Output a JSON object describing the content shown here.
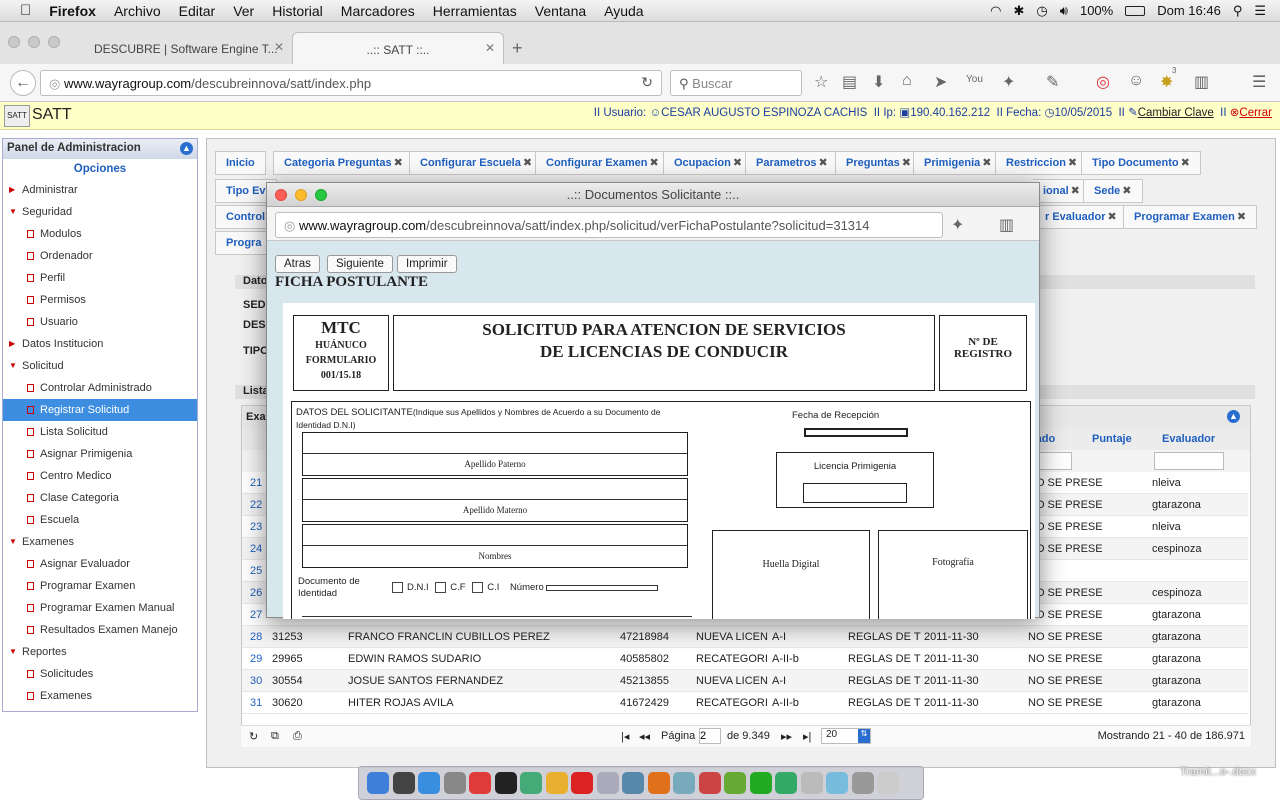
{
  "menubar": {
    "app": "Firefox",
    "items": [
      "Archivo",
      "Editar",
      "Ver",
      "Historial",
      "Marcadores",
      "Herramientas",
      "Ventana",
      "Ayuda"
    ],
    "battery": "100%",
    "clock": "Dom 16:46"
  },
  "browser": {
    "tabs": [
      {
        "title": "DESCUBRE | Software Engine T..."
      },
      {
        "title": "..:: SATT ::.."
      }
    ],
    "url_domain": "www.wayragroup.com",
    "url_path": "/descubreinnova/satt/index.php",
    "search_placeholder": "Buscar",
    "badge": "3"
  },
  "satt": {
    "logo_text": "SATT",
    "title": "SATT",
    "user_label": "II  Usuario:",
    "user": "CESAR AUGUSTO ESPINOZA CACHIS",
    "ip_label": "II  Ip:",
    "ip": "190.40.162.212",
    "date_label": "II  Fecha:",
    "date": "10/05/2015",
    "sep": "II",
    "change_pwd": "Cambiar Clave",
    "logout": "Cerrar"
  },
  "sidebar": {
    "title": "Panel de Administracion",
    "options": "Opciones",
    "items": [
      {
        "label": "Administrar",
        "level": 1
      },
      {
        "label": "Seguridad",
        "level": 1
      },
      {
        "label": "Modulos",
        "level": 2
      },
      {
        "label": "Ordenador",
        "level": 2
      },
      {
        "label": "Perfil",
        "level": 2
      },
      {
        "label": "Permisos",
        "level": 2
      },
      {
        "label": "Usuario",
        "level": 2
      },
      {
        "label": "Datos Institucion",
        "level": 1
      },
      {
        "label": "Solicitud",
        "level": 1
      },
      {
        "label": "Controlar Administrado",
        "level": 2
      },
      {
        "label": "Registrar Solicitud",
        "level": 2,
        "selected": true
      },
      {
        "label": "Lista Solicitud",
        "level": 2
      },
      {
        "label": "Asignar Primigenia",
        "level": 2
      },
      {
        "label": "Centro Medico",
        "level": 2
      },
      {
        "label": "Clase Categoria",
        "level": 2
      },
      {
        "label": "Escuela",
        "level": 2
      },
      {
        "label": "Examenes",
        "level": 1
      },
      {
        "label": "Asignar Evaluador",
        "level": 2
      },
      {
        "label": "Programar Examen",
        "level": 2
      },
      {
        "label": "Programar Examen Manual",
        "level": 2
      },
      {
        "label": "Resultados Examen Manejo",
        "level": 2
      },
      {
        "label": "Reportes",
        "level": 1
      },
      {
        "label": "Solicitudes",
        "level": 2
      },
      {
        "label": "Examenes",
        "level": 2
      }
    ]
  },
  "main_tabs": {
    "row1": [
      "Inicio",
      "Categoria Preguntas",
      "Configurar Escuela",
      "Configurar Examen",
      "Ocupacion",
      "Parametros",
      "Preguntas",
      "Primigenia",
      "Restriccion",
      "Tipo Documento"
    ],
    "row2_visible": [
      "Tipo Ev",
      "ional",
      "Sede"
    ],
    "row3_visible": [
      "Control",
      "r Evaluador",
      "Programar Examen"
    ],
    "row4_visible": [
      "Progra"
    ]
  },
  "sections": {
    "datos": "Dato",
    "fields": [
      "SED",
      "DES",
      "TIPO"
    ],
    "lista": "Lista",
    "exam": "Exam"
  },
  "grid": {
    "headers": {
      "estado": "tado",
      "puntaje": "Puntaje",
      "evaluador": "Evaluador"
    },
    "partial_rows": [
      {
        "n": "21",
        "estado": "NO SE PRESE",
        "evaluador": "nleiva"
      },
      {
        "n": "22",
        "estado": "NO SE PRESE",
        "evaluador": "gtarazona"
      },
      {
        "n": "23",
        "estado": "NO SE PRESE",
        "evaluador": "nleiva"
      },
      {
        "n": "24",
        "estado": "NO SE PRESE",
        "evaluador": "cespinoza"
      },
      {
        "n": "25",
        "estado": "",
        "evaluador": ""
      },
      {
        "n": "26",
        "estado": "NO SE PRESE",
        "evaluador": "cespinoza"
      },
      {
        "n": "27",
        "estado": "NO SE PRESE",
        "evaluador": "gtarazona"
      }
    ],
    "rows": [
      {
        "n": "28",
        "id": "31253",
        "name": "FRANCO FRANCLIN CUBILLOS PEREZ",
        "dni": "47218984",
        "tramite": "NUEVA LICEN",
        "cat": "A-I",
        "exam": "REGLAS DE T",
        "date": "2011-11-30",
        "estado": "NO SE PRESE",
        "evaluador": "gtarazona"
      },
      {
        "n": "29",
        "id": "29965",
        "name": "EDWIN RAMOS SUDARIO",
        "dni": "40585802",
        "tramite": "RECATEGORI",
        "cat": "A-II-b",
        "exam": "REGLAS DE T",
        "date": "2011-11-30",
        "estado": "NO SE PRESE",
        "evaluador": "gtarazona"
      },
      {
        "n": "30",
        "id": "30554",
        "name": "JOSUE SANTOS FERNANDEZ",
        "dni": "45213855",
        "tramite": "NUEVA LICEN",
        "cat": "A-I",
        "exam": "REGLAS DE T",
        "date": "2011-11-30",
        "estado": "NO SE PRESE",
        "evaluador": "gtarazona"
      },
      {
        "n": "31",
        "id": "30620",
        "name": "HITER ROJAS AVILA",
        "dni": "41672429",
        "tramite": "RECATEGORI",
        "cat": "A-II-b",
        "exam": "REGLAS DE T",
        "date": "2011-11-30",
        "estado": "NO SE PRESE",
        "evaluador": "gtarazona"
      }
    ]
  },
  "pager": {
    "page_label": "Página",
    "page": "2",
    "of": "de 9.349",
    "per_page": "20",
    "summary": "Mostrando 21 - 40 de 186.971"
  },
  "popup": {
    "title": "..:: Documentos Solicitante ::..",
    "url_domain": "www.wayragroup.com",
    "url_path": "/descubreinnova/satt/index.php/solicitud/verFichaPostulante?solicitud=31314",
    "buttons": {
      "back": "Atras",
      "next": "Siguiente",
      "print": "Imprimir"
    },
    "heading": "FICHA POSTULANTE",
    "form": {
      "mtc": "MTC",
      "region": "HUÁNUCO",
      "formulario": "FORMULARIO",
      "code": "001/15.18",
      "title1": "SOLICITUD PARA ATENCION DE SERVICIOS",
      "title2": "DE LICENCIAS DE CONDUCIR",
      "reg1": "Nº DE",
      "reg2": "REGISTRO",
      "datos_title": "DATOS DEL SOLICITANTE",
      "datos_note": "(Indique sus Apellidos y Nombres de Acuerdo a su Documento de Identidad D.N.I)",
      "apellido_paterno": "Apellido Paterno",
      "apellido_materno": "Apellido Materno",
      "nombres": "Nombres",
      "fecha_recepcion": "Fecha de Recepción",
      "licencia_primigenia": "Licencia Primigenia",
      "huella": "Huella Digital",
      "foto": "Fotografía",
      "doc_identidad_1": "Documento de",
      "doc_identidad_2": "Identidad",
      "dni": "D.N.I",
      "cf": "C.F",
      "ci": "C.I",
      "numero": "Número"
    }
  },
  "dock": {
    "desktop_item": "Tramit...o-.docx"
  }
}
